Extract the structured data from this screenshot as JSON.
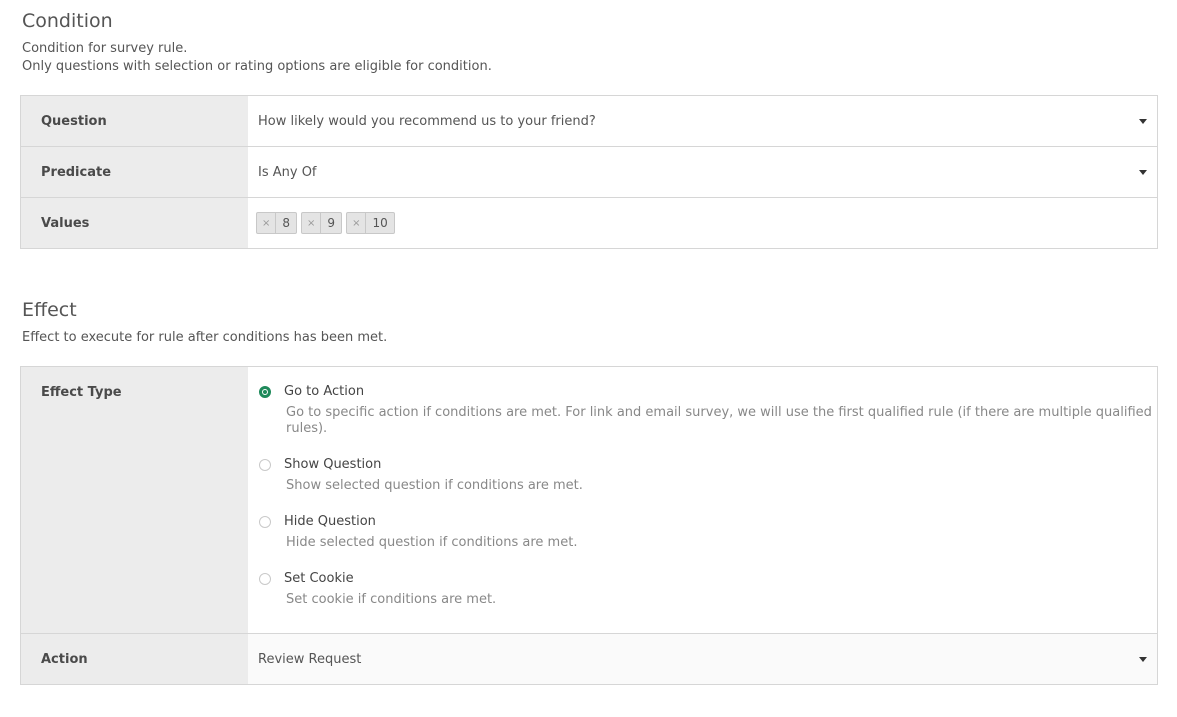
{
  "condition": {
    "title": "Condition",
    "desc_line1": "Condition for survey rule.",
    "desc_line2": "Only questions with selection or rating options are eligible for condition.",
    "rows": {
      "question_label": "Question",
      "question_value": "How likely would you recommend us to your friend?",
      "predicate_label": "Predicate",
      "predicate_value": "Is Any Of",
      "values_label": "Values",
      "values": [
        "8",
        "9",
        "10"
      ],
      "tag_remove_glyph": "×"
    }
  },
  "effect": {
    "title": "Effect",
    "desc": "Effect to execute for rule after conditions has been met.",
    "effect_type_label": "Effect Type",
    "options": [
      {
        "label": "Go to Action",
        "help": "Go to specific action if conditions are met. For link and email survey, we will use the first qualified rule (if there are multiple qualified rules).",
        "checked": true
      },
      {
        "label": "Show Question",
        "help": "Show selected question if conditions are met.",
        "checked": false
      },
      {
        "label": "Hide Question",
        "help": "Hide selected question if conditions are met.",
        "checked": false
      },
      {
        "label": "Set Cookie",
        "help": "Set cookie if conditions are met.",
        "checked": false
      }
    ],
    "action_label": "Action",
    "action_value": "Review Request"
  },
  "colors": {
    "accent_green": "#1f8a5b",
    "label_bg": "#ececec",
    "border": "#d6d6d6"
  },
  "icons": {
    "select_caret": "caret-down-icon",
    "tag_remove": "close-icon",
    "radio": "radio-icon"
  }
}
